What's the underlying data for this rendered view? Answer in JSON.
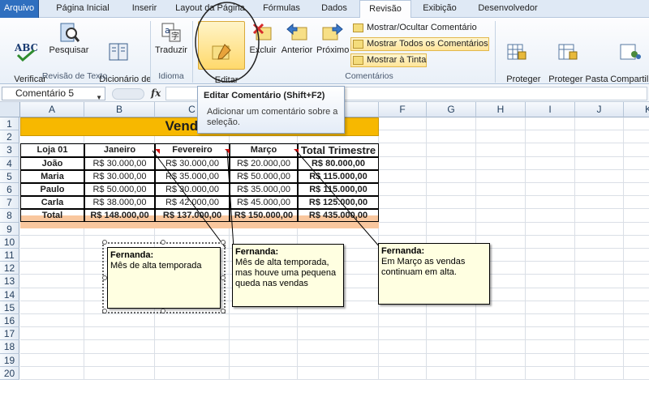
{
  "tabs": [
    {
      "label": "Arquivo"
    },
    {
      "label": "Página Inicial"
    },
    {
      "label": "Inserir"
    },
    {
      "label": "Layout da Página"
    },
    {
      "label": "Fórmulas"
    },
    {
      "label": "Dados"
    },
    {
      "label": "Revisão"
    },
    {
      "label": "Exibição"
    },
    {
      "label": "Desenvolvedor"
    }
  ],
  "active_tab": "Revisão",
  "ribbon": {
    "revisao_texto": {
      "label": "Revisão de Texto",
      "verificar": "Verificar\nOrtografia",
      "pesquisar": "Pesquisar",
      "dicionario": "Dicionário de\nSinônimos"
    },
    "idioma": {
      "label": "Idioma",
      "traduzir": "Traduzir"
    },
    "comentarios": {
      "label": "Comentários",
      "editar": "Editar\nComentário",
      "excluir": "Excluir",
      "anterior": "Anterior",
      "proximo": "Próximo",
      "mostrar_ocultar": "Mostrar/Ocultar Comentário",
      "mostrar_todos": "Mostrar Todos os Comentários",
      "mostrar_tinta": "Mostrar à Tinta"
    },
    "alteracoes": {
      "proteger_planilha": "Proteger\nPlanilha",
      "proteger_pasta": "Proteger Pasta\nde Trabalho",
      "compartilhar": "Compartilh\nPasta de Trab"
    }
  },
  "namebox": "Comentário 5",
  "fx": "fx",
  "tooltip": {
    "title": "Editar Comentário (Shift+F2)",
    "desc": "Adicionar um comentário sobre a seleção."
  },
  "columns": [
    "A",
    "B",
    "C",
    "D",
    "E",
    "F",
    "G",
    "H",
    "I",
    "J",
    "K"
  ],
  "rows": [
    "1",
    "2",
    "3",
    "4",
    "5",
    "6",
    "7",
    "8",
    "9",
    "10",
    "11",
    "12",
    "13",
    "14",
    "15",
    "16",
    "17",
    "18",
    "19",
    "20"
  ],
  "sheet": {
    "title": "Vendas Tri",
    "headers": [
      "Loja 01",
      "Janeiro",
      "Fevereiro",
      "Março",
      "Total Trimestre"
    ],
    "data": [
      [
        "João",
        "R$ 30.000,00",
        "R$ 30.000,00",
        "R$ 20.000,00",
        "R$ 80.000,00"
      ],
      [
        "Maria",
        "R$ 30.000,00",
        "R$ 35.000,00",
        "R$ 50.000,00",
        "R$ 115.000,00"
      ],
      [
        "Paulo",
        "R$ 50.000,00",
        "R$ 30.000,00",
        "R$ 35.000,00",
        "R$ 115.000,00"
      ],
      [
        "Carla",
        "R$ 38.000,00",
        "R$ 42.000,00",
        "R$ 45.000,00",
        "R$ 125.000,00"
      ]
    ],
    "total": [
      "Total",
      "R$ 148.000,00",
      "R$ 137.000,00",
      "R$ 150.000,00",
      "R$ 435.000,00"
    ]
  },
  "comments": [
    {
      "author": "Fernanda:",
      "text": "Mês de alta temporada"
    },
    {
      "author": "Fernanda:",
      "text": "Mês de alta temporada, mas houve uma pequena queda nas vendas"
    },
    {
      "author": "Fernanda:",
      "text": "Em Março as vendas continuam em alta."
    }
  ],
  "colors": {
    "title_band": "#f7b800",
    "total_band": "#f9c79e",
    "comment_bg": "#ffffe1",
    "file_tab": "#2f6fbf"
  }
}
